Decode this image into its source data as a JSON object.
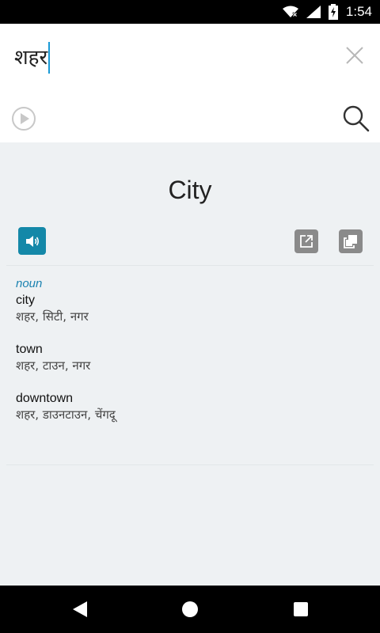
{
  "status_bar": {
    "time": "1:54",
    "icons": [
      "wifi-icon",
      "signal-icon",
      "battery-charging-icon"
    ]
  },
  "input": {
    "value": "शहर",
    "clear_icon": "close-icon",
    "play_icon": "play-circle-icon",
    "search_icon": "search-icon"
  },
  "result": {
    "title": "City",
    "actions": {
      "speak_icon": "speaker-icon",
      "share_icon": "open-external-icon",
      "copy_icon": "copy-icon"
    },
    "part_of_speech": "noun",
    "entries": [
      {
        "word": "city",
        "translations": "शहर, सिटी, नगर"
      },
      {
        "word": "town",
        "translations": "शहर, टाउन, नगर"
      },
      {
        "word": "downtown",
        "translations": "शहर, डाउनटाउन, चेंगदू"
      }
    ]
  },
  "nav_bar": {
    "icons": [
      "back-icon",
      "home-icon",
      "recents-icon"
    ]
  },
  "colors": {
    "accent": "#1488a8",
    "pos_label": "#1a82b0",
    "result_bg": "#eef1f3",
    "cursor": "#1a9ad6",
    "action_grey": "#8a8a8a"
  }
}
